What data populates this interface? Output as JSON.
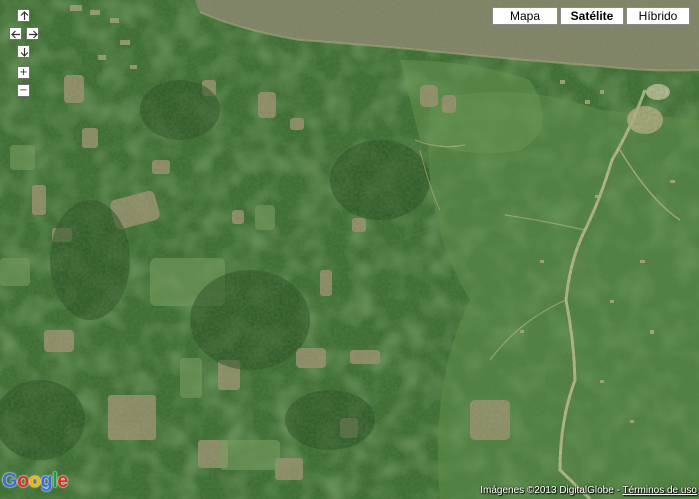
{
  "map": {
    "type_buttons": [
      {
        "label": "Mapa",
        "active": false
      },
      {
        "label": "Satélite",
        "active": true
      },
      {
        "label": "Híbrido",
        "active": false
      }
    ],
    "nav": {
      "pan_up": "up-arrow",
      "pan_left": "left-arrow",
      "pan_right": "right-arrow",
      "pan_down": "down-arrow",
      "zoom_in": "+",
      "zoom_out": "−"
    },
    "logo_letters": [
      "G",
      "o",
      "o",
      "g",
      "l",
      "e"
    ],
    "logo_colors": [
      "#3a6ed8",
      "#d93025",
      "#f2b400",
      "#3a6ed8",
      "#1e9e3e",
      "#d93025"
    ],
    "attribution": "Imágenes ©2013 DigitalGlobe -",
    "terms_link": "Términos de uso",
    "colors": {
      "forest_dark": "#2f5d28",
      "forest_mid": "#3f7335",
      "forest_light": "#5c8f4a",
      "clearing": "#a8957a",
      "river": "#8d8573",
      "road": "#d8c6a0"
    }
  }
}
